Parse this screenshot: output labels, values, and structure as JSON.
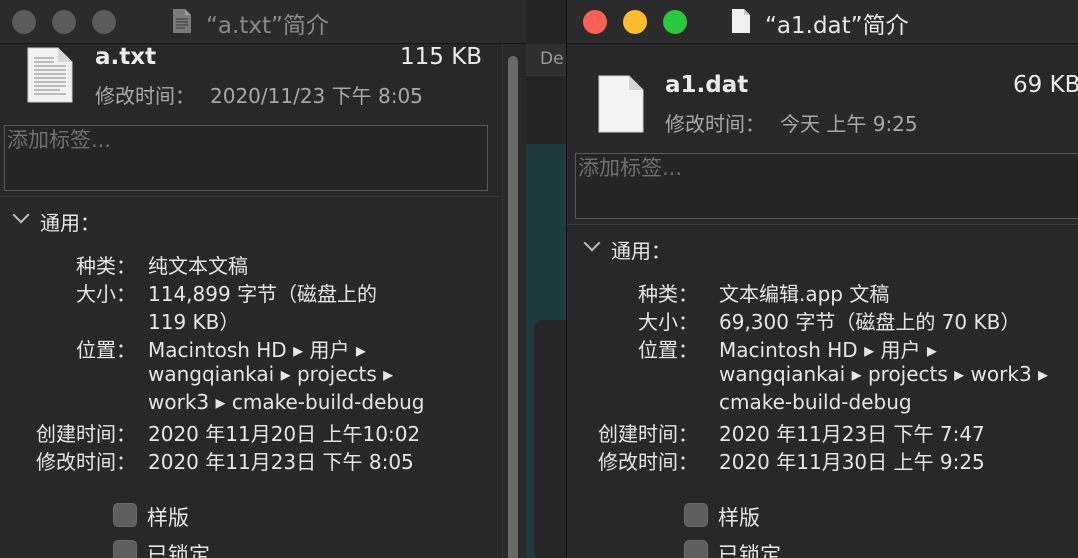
{
  "background_app": {
    "toolbar_text": "De"
  },
  "left_window": {
    "title": "“a.txt”简介",
    "file_name": "a.txt",
    "file_size": "115 KB",
    "modified_label": "修改时间：",
    "modified_value": "2020/11/23 下午 8:05",
    "tags_placeholder": "添加标签...",
    "general_header": "通用：",
    "rows": {
      "kind_label": "种类：",
      "kind_value": "纯文本文稿",
      "size_label": "大小：",
      "size_value_1": "114,899 字节（磁盘上的",
      "size_value_2": "119 KB）",
      "where_label": "位置：",
      "where_1": "Macintosh HD ▸ 用户 ▸",
      "where_2": "wangqiankai ▸ projects ▸",
      "where_3": "work3 ▸ cmake-build-debug",
      "created_label": "创建时间：",
      "created_value": "2020 年11月20日 上午10:02",
      "modified_label": "修改时间：",
      "modified_value": "2020 年11月23日 下午 8:05"
    },
    "stationery_label": "样版",
    "locked_label": "已锁定"
  },
  "right_window": {
    "title": "“a1.dat”简介",
    "file_name": "a1.dat",
    "file_size": "69 KB",
    "modified_label": "修改时间：",
    "modified_value": "今天 上午 9:25",
    "tags_placeholder": "添加标签...",
    "general_header": "通用：",
    "rows": {
      "kind_label": "种类：",
      "kind_value": "文本编辑.app 文稿",
      "size_label": "大小：",
      "size_value": "69,300 字节（磁盘上的 70 KB）",
      "where_label": "位置：",
      "where_1": "Macintosh HD ▸ 用户 ▸",
      "where_2": "wangqiankai ▸ projects ▸ work3 ▸",
      "where_3": "cmake-build-debug",
      "created_label": "创建时间：",
      "created_value": "2020 年11月23日 下午 7:47",
      "modified_label": "修改时间：",
      "modified_value": "2020 年11月30日 上午 9:25"
    },
    "stationery_label": "样版",
    "locked_label": "已锁定"
  },
  "colors": {
    "close": "#fe5f57",
    "minimize": "#febc2e",
    "zoom": "#28c840",
    "window_bg": "#282828"
  },
  "icons": [
    "document-icon",
    "text-document-icon",
    "disclosure-chevron-icon"
  ]
}
